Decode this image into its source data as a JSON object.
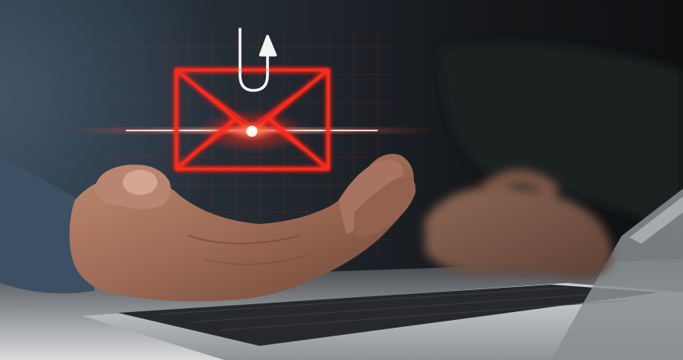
{
  "image": {
    "subject": "phishing-email-hook-over-hand-and-laptop",
    "icons": [
      "envelope-icon",
      "fish-hook-icon"
    ],
    "colors": {
      "background_dark": "#1a1d22",
      "shirt_blue": "#3c4f60",
      "skin": "#a67560",
      "neon_red": "#ff2a1e",
      "hook_white": "#f4f4f4",
      "laptop_silver": "#b9bcbf",
      "keyboard": "#27292c"
    }
  }
}
